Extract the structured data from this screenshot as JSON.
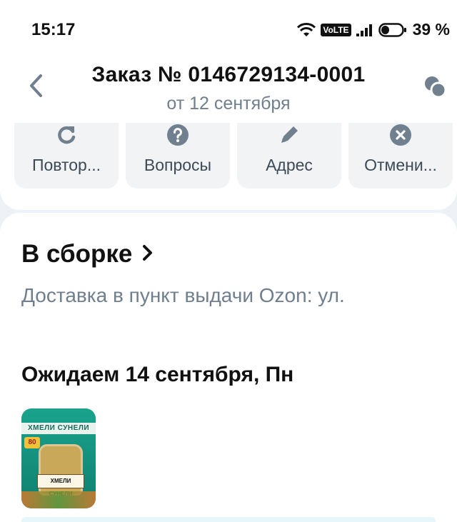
{
  "status_bar": {
    "time": "15:17",
    "network_badge": "VoLTE",
    "battery_percent": "39 %",
    "battery_level": 0.39
  },
  "header": {
    "title": "Заказ № 0146729134-0001",
    "subtitle": "от 12 сентября",
    "back_icon": "chevron-left-icon",
    "chat_icon": "chat-bubbles-icon"
  },
  "actions": [
    {
      "label": "Повтор...",
      "icon": "refresh-icon"
    },
    {
      "label": "Вопросы",
      "icon": "question-icon"
    },
    {
      "label": "Адрес",
      "icon": "pencil-icon"
    },
    {
      "label": "Отмени...",
      "icon": "close-circle-icon"
    }
  ],
  "order_status": {
    "title": "В сборке",
    "delivery": "Доставка в пункт выдачи Ozon: ул.",
    "expected": "Ожидаем 14 сентября, Пн"
  },
  "product": {
    "brand": "ХМЕЛИ СУНЕЛИ",
    "jar_label": "ХМЕЛИ СУНЕЛИ",
    "weight": "80"
  },
  "colors": {
    "background": "#eef1f6",
    "card": "#ffffff",
    "action_bg": "#f2f3f5",
    "icon": "#70808e",
    "primary_text": "#111111",
    "secondary_text": "#707f8d"
  }
}
